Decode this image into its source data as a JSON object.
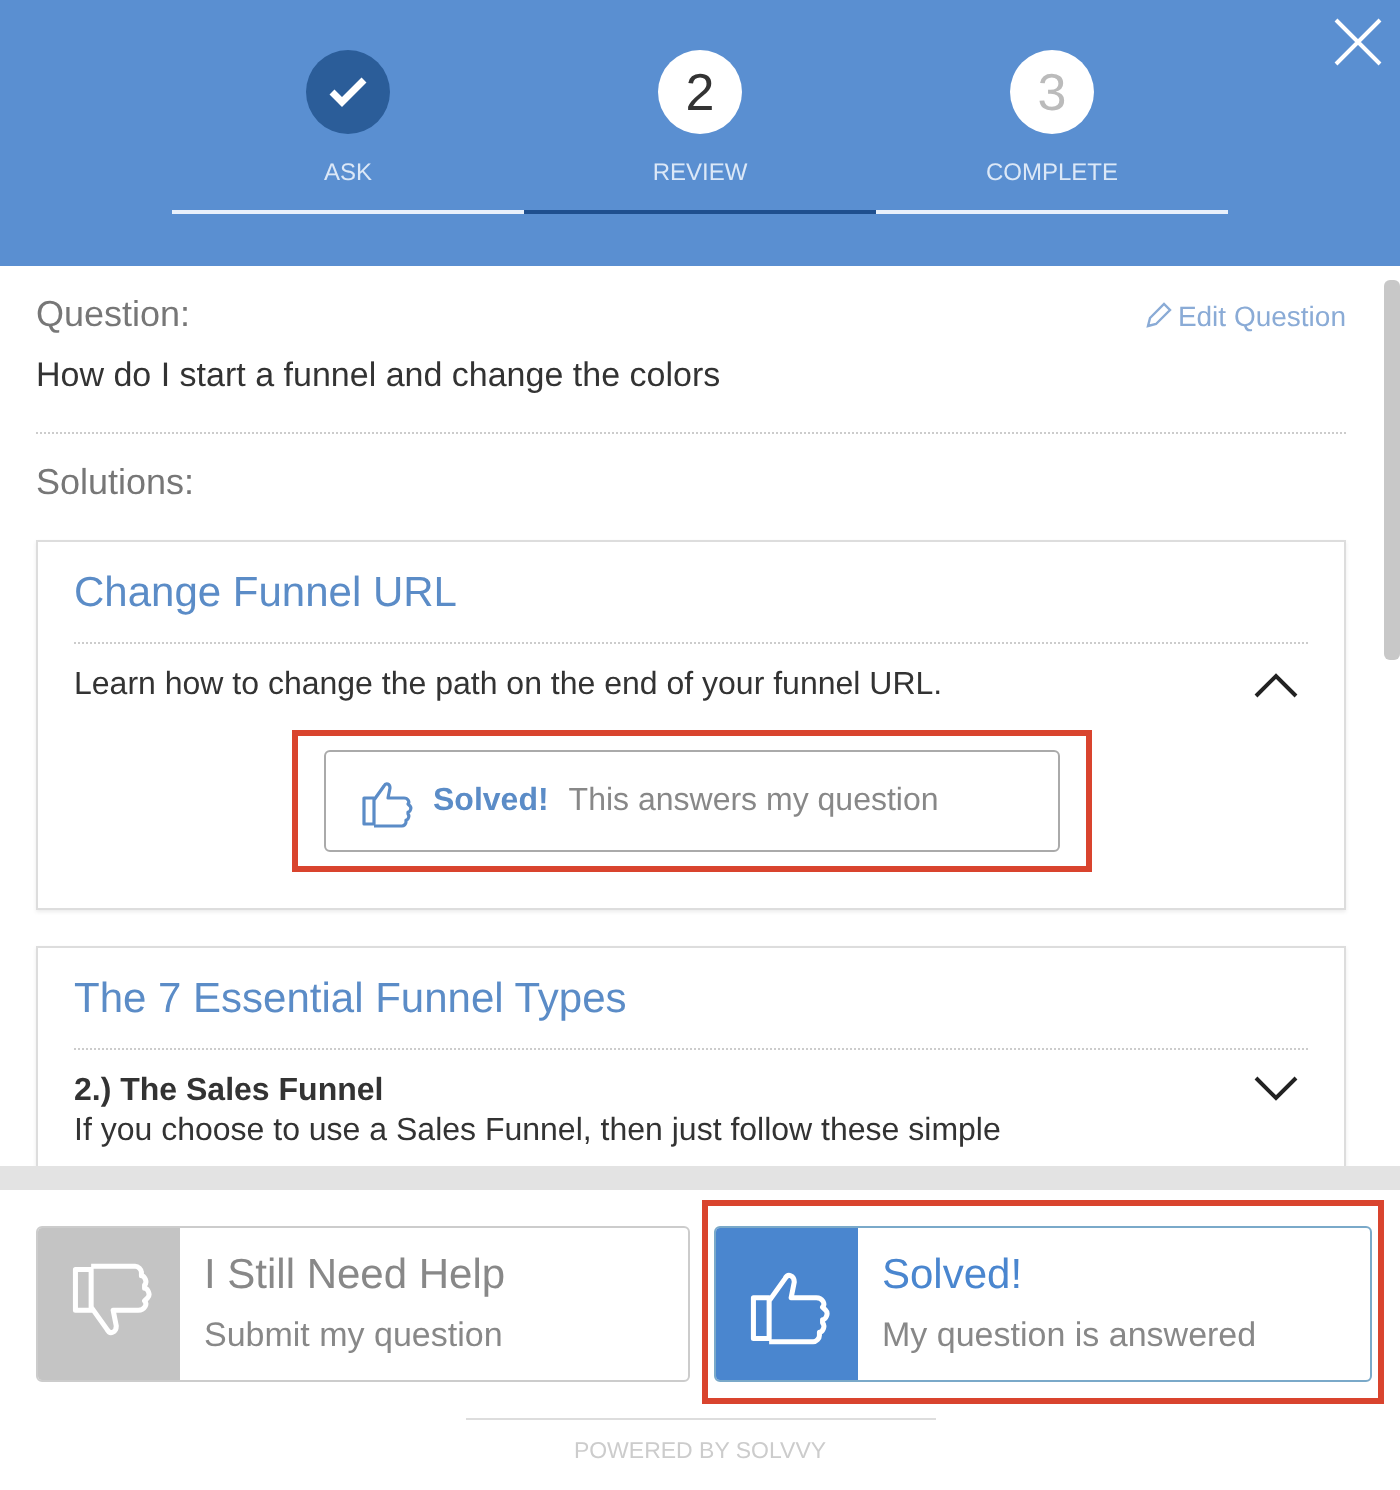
{
  "steps": [
    {
      "label": "ASK",
      "done": true,
      "selected": false
    },
    {
      "number": "2",
      "label": "REVIEW",
      "done": false,
      "selected": true
    },
    {
      "number": "3",
      "label": "COMPLETE",
      "done": false,
      "selected": false
    }
  ],
  "question": {
    "label": "Question:",
    "edit_link": "Edit Question",
    "text": "How do I start a funnel and change the colors"
  },
  "solutions_label": "Solutions:",
  "solutions": [
    {
      "title": "Change Funnel URL",
      "summary": "Learn how to change the path on the end of your funnel URL.",
      "expanded": true,
      "solved_button": {
        "strong": "Solved!",
        "text": "This answers my question",
        "highlighted": true
      }
    },
    {
      "title": "The 7 Essential Funnel Types",
      "heading": "2.) The Sales Funnel",
      "summary": "If you choose to use a Sales Funnel, then just follow these simple",
      "expanded": false
    }
  ],
  "actions": [
    {
      "kind": "unsolved",
      "title": "I Still Need Help",
      "subtitle": "Submit my question",
      "highlighted": false
    },
    {
      "kind": "solved",
      "title": "Solved!",
      "subtitle": "My question is answered",
      "highlighted": true
    }
  ],
  "footer": "POWERED BY SOLVVY"
}
